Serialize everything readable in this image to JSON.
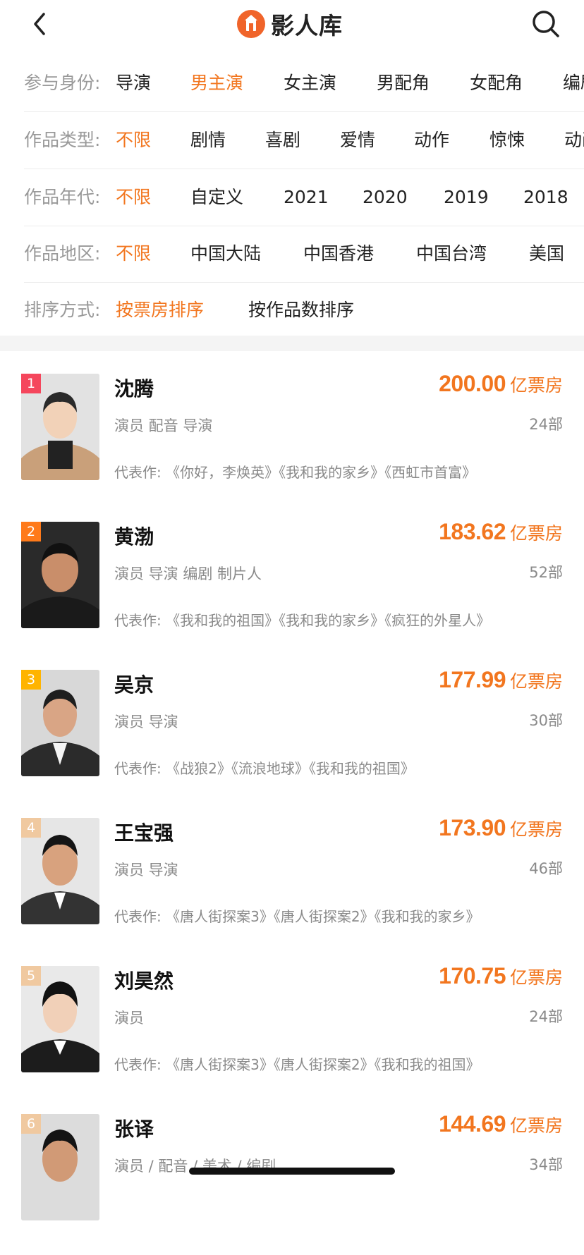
{
  "header": {
    "title": "影人库",
    "back_icon": "chevron-left-icon",
    "search_icon": "search-icon",
    "logo_color": "#f0642a"
  },
  "filters": [
    {
      "label": "参与身份:",
      "options": [
        "导演",
        "男主演",
        "女主演",
        "男配角",
        "女配角",
        "编剧"
      ],
      "active": 1
    },
    {
      "label": "作品类型:",
      "options": [
        "不限",
        "剧情",
        "喜剧",
        "爱情",
        "动作",
        "惊悚",
        "动画"
      ],
      "active": 0
    },
    {
      "label": "作品年代:",
      "options": [
        "不限",
        "自定义",
        "2021",
        "2020",
        "2019",
        "2018"
      ],
      "active": 0
    },
    {
      "label": "作品地区:",
      "options": [
        "不限",
        "中国大陆",
        "中国香港",
        "中国台湾",
        "美国"
      ],
      "active": 0
    },
    {
      "label": "排序方式:",
      "options": [
        "按票房排序",
        "按作品数排序"
      ],
      "active": 0
    }
  ],
  "accent_color": "#f2761f",
  "list": [
    {
      "rank": "1",
      "rank_color": "#f5465c",
      "name": "沈腾",
      "roles": "演员 配音 导演",
      "box_office": "200.00",
      "unit": "亿票房",
      "count": "24部",
      "works": "代表作: 《你好，李焕英》《我和我的家乡》《西虹市首富》"
    },
    {
      "rank": "2",
      "rank_color": "#ff7a1a",
      "name": "黄渤",
      "roles": "演员 导演 编剧 制片人",
      "box_office": "183.62",
      "unit": "亿票房",
      "count": "52部",
      "works": "代表作: 《我和我的祖国》《我和我的家乡》《疯狂的外星人》"
    },
    {
      "rank": "3",
      "rank_color": "#ffb400",
      "name": "吴京",
      "roles": "演员 导演",
      "box_office": "177.99",
      "unit": "亿票房",
      "count": "30部",
      "works": "代表作: 《战狼2》《流浪地球》《我和我的祖国》"
    },
    {
      "rank": "4",
      "rank_color": "#f0c9a0",
      "name": "王宝强",
      "roles": "演员 导演",
      "box_office": "173.90",
      "unit": "亿票房",
      "count": "46部",
      "works": "代表作: 《唐人街探案3》《唐人街探案2》《我和我的家乡》"
    },
    {
      "rank": "5",
      "rank_color": "#f0c9a0",
      "name": "刘昊然",
      "roles": "演员",
      "box_office": "170.75",
      "unit": "亿票房",
      "count": "24部",
      "works": "代表作: 《唐人街探案3》《唐人街探案2》《我和我的祖国》"
    },
    {
      "rank": "6",
      "rank_color": "#f0c9a0",
      "name": "张译",
      "roles": "演员 / 配音 / 美术 / 编剧",
      "box_office": "144.69",
      "unit": "亿票房",
      "count": "34部",
      "works": ""
    }
  ]
}
